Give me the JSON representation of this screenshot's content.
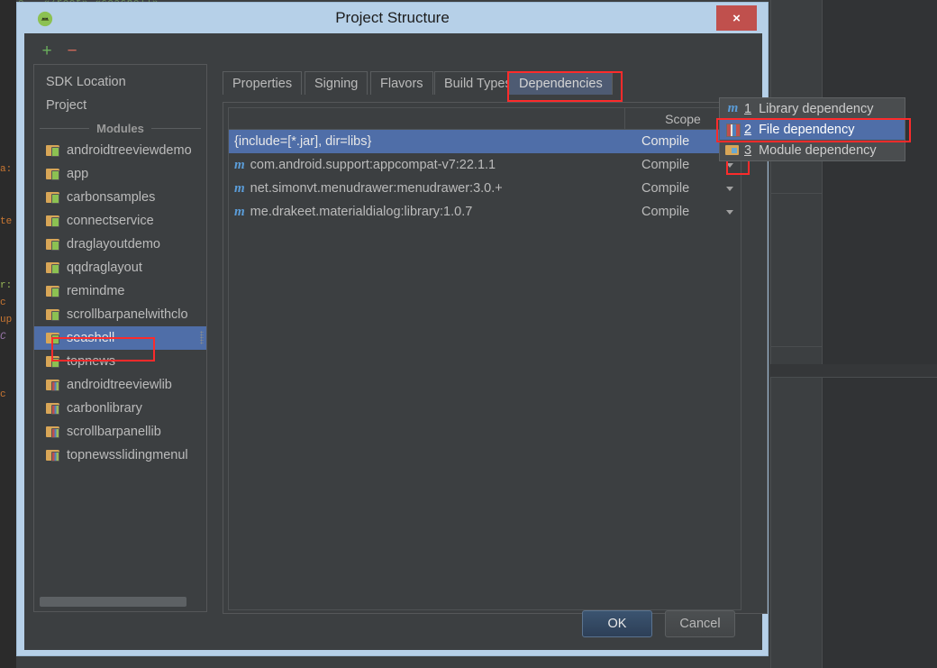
{
  "window": {
    "title": "Project Structure",
    "app_icon": "android-studio-icon",
    "close_label": "×"
  },
  "background": {
    "top_code": "e   «/root» «seashell»",
    "code_lines": [
      "a:",
      "te",
      "r:",
      "c",
      "up",
      "C",
      "c"
    ]
  },
  "sidebar": {
    "toolbar": {
      "add_label": "+",
      "remove_label": "−"
    },
    "nav": [
      {
        "label": "SDK Location"
      },
      {
        "label": "Project"
      }
    ],
    "group_label": "Modules",
    "modules": [
      {
        "label": "androidtreeviewdemo",
        "icon": "app-module-icon",
        "selected": false
      },
      {
        "label": "app",
        "icon": "app-module-icon",
        "selected": false
      },
      {
        "label": "carbonsamples",
        "icon": "app-module-icon",
        "selected": false
      },
      {
        "label": "connectservice",
        "icon": "app-module-icon",
        "selected": false
      },
      {
        "label": "draglayoutdemo",
        "icon": "app-module-icon",
        "selected": false
      },
      {
        "label": "qqdraglayout",
        "icon": "app-module-icon",
        "selected": false
      },
      {
        "label": "remindme",
        "icon": "app-module-icon",
        "selected": false
      },
      {
        "label": "scrollbarpanelwithclo",
        "icon": "app-module-icon",
        "selected": false
      },
      {
        "label": "seashell",
        "icon": "app-module-icon",
        "selected": true
      },
      {
        "label": "topnews",
        "icon": "app-module-icon",
        "selected": false
      },
      {
        "label": "androidtreeviewlib",
        "icon": "library-module-icon",
        "selected": false
      },
      {
        "label": "carbonlibrary",
        "icon": "library-module-icon",
        "selected": false
      },
      {
        "label": "scrollbarpanellib",
        "icon": "library-module-icon",
        "selected": false
      },
      {
        "label": "topnewsslidingmenul",
        "icon": "library-module-icon",
        "selected": false
      }
    ]
  },
  "tabs": [
    {
      "label": "Properties",
      "active": false
    },
    {
      "label": "Signing",
      "active": false
    },
    {
      "label": "Flavors",
      "active": false
    },
    {
      "label": "Build Types",
      "active": false
    },
    {
      "label": "Dependencies",
      "active": true
    }
  ],
  "dependencies": {
    "columns": {
      "name": "",
      "scope": "Scope"
    },
    "add_label": "+",
    "rows": [
      {
        "name": "{include=[*.jar], dir=libs}",
        "has_m_icon": false,
        "scope": "Compile",
        "selected": true
      },
      {
        "name": "com.android.support:appcompat-v7:22.1.1",
        "has_m_icon": true,
        "scope": "Compile",
        "selected": false
      },
      {
        "name": "net.simonvt.menudrawer:menudrawer:3.0.+",
        "has_m_icon": true,
        "scope": "Compile",
        "selected": false
      },
      {
        "name": "me.drakeet.materialdialog:library:1.0.7",
        "has_m_icon": true,
        "scope": "Compile",
        "selected": false
      }
    ]
  },
  "dependency_menu": [
    {
      "num": "1",
      "label": "Library dependency",
      "icon": "maven-m-icon",
      "selected": false
    },
    {
      "num": "2",
      "label": "File dependency",
      "icon": "books-icon",
      "selected": true
    },
    {
      "num": "3",
      "label": "Module dependency",
      "icon": "folder-module-icon",
      "selected": false
    }
  ],
  "buttons": {
    "ok": "OK",
    "cancel": "Cancel"
  },
  "colors": {
    "accent_selection": "#4f6ea8",
    "highlight_box": "#fc2b2b",
    "titlebar": "#b6d0e8",
    "close_button": "#c0504d",
    "panel_bg": "#3c3f41",
    "add_green": "#6aaf5c",
    "remove_red": "#cf6a5a"
  }
}
